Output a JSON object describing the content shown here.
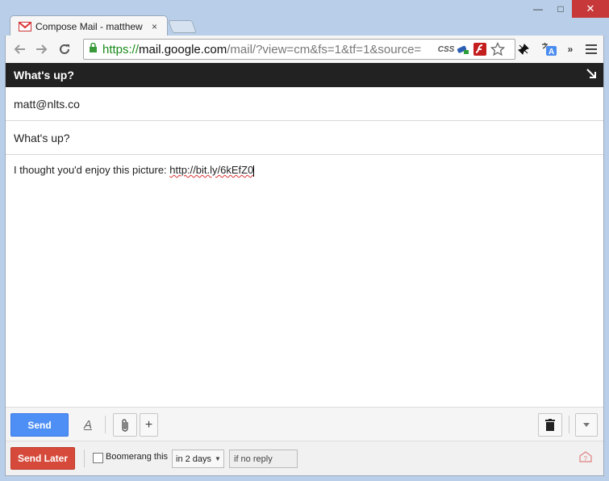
{
  "browser": {
    "tab_title": "Compose Mail - matthew",
    "tab_close": "×",
    "win_minimize": "—",
    "win_maximize": "□",
    "win_close": "✕",
    "url_scheme": "https://",
    "url_host": "mail.google.com",
    "url_rest": "/mail/?view=cm&fs=1&tf=1&source=",
    "ext_css_label": "CSS",
    "overflow_label": "»"
  },
  "compose": {
    "header_title": "What's up?",
    "to": "matt@nlts.co",
    "subject": "What's up?",
    "body_prefix": "I thought you'd enjoy this picture: ",
    "body_link": "http://bit.ly/6kEfZ0"
  },
  "actions": {
    "send_label": "Send",
    "format_label": "A",
    "add_label": "+"
  },
  "boomerang": {
    "send_later_label": "Send Later",
    "checkbox_label": "Boomerang this",
    "when_value": "in 2 days",
    "condition_placeholder": "if no reply"
  },
  "colors": {
    "send_blue": "#4d8ff5",
    "send_later_red": "#d54a3a",
    "header_dark": "#222222"
  }
}
